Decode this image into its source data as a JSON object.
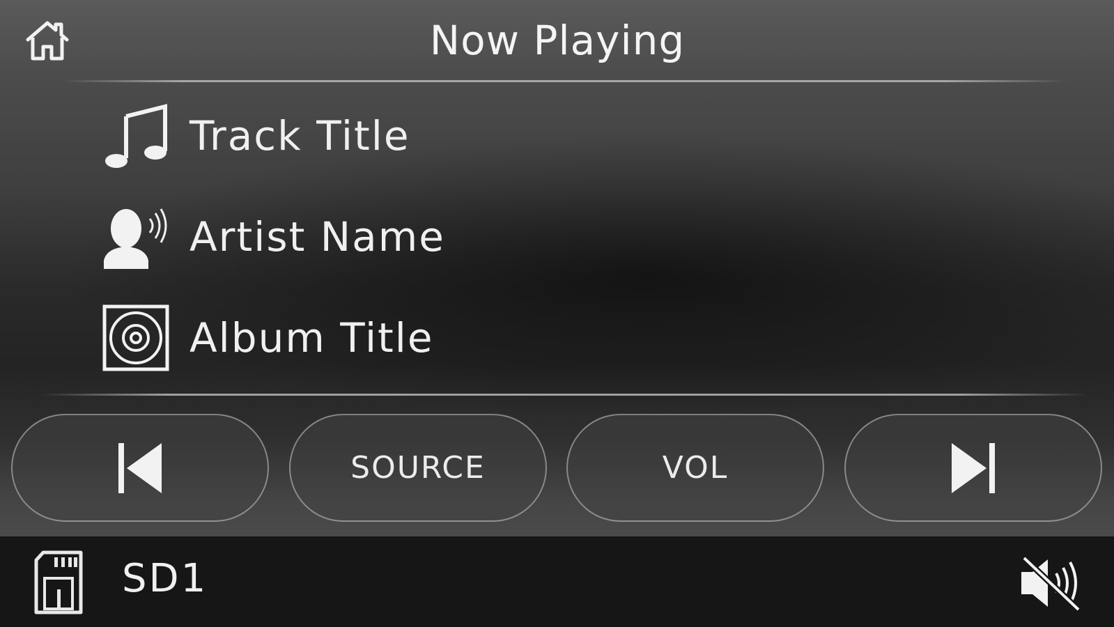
{
  "header": {
    "title": "Now Playing",
    "home_icon": "home-icon"
  },
  "now_playing": {
    "track_title": "Track Title",
    "artist_name": "Artist Name",
    "album_title": "Album Title",
    "icons": [
      "music-note-icon",
      "artist-icon",
      "album-disc-icon"
    ]
  },
  "controls": {
    "previous_icon": "skip-previous-icon",
    "source_label": "SOURCE",
    "volume_label": "VOL",
    "next_icon": "skip-next-icon"
  },
  "status_bar": {
    "source_icon": "sd-card-icon",
    "source_name": "SD1",
    "mute_icon": "speaker-muted-icon"
  },
  "colors": {
    "text": "#f2f2f2",
    "status_bar_bg": "#161616",
    "button_border": "#c8c8c8"
  }
}
